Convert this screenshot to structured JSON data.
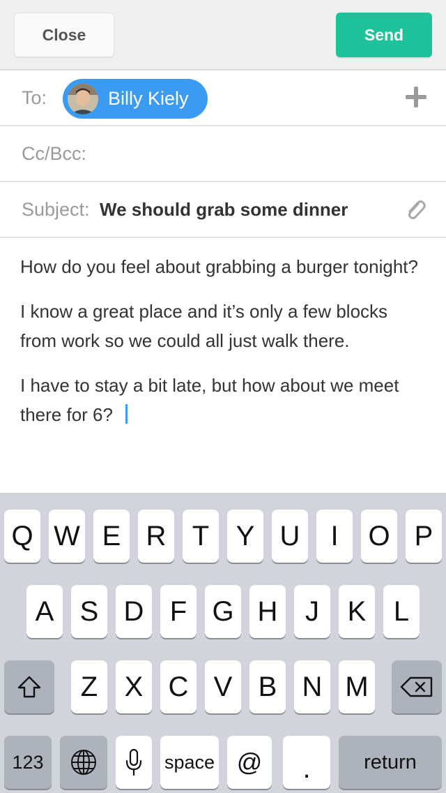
{
  "toolbar": {
    "close_label": "Close",
    "send_label": "Send"
  },
  "to": {
    "label": "To:",
    "recipient": "Billy Kiely"
  },
  "cc": {
    "label": "Cc/Bcc:"
  },
  "subject": {
    "label": "Subject:",
    "value": "We should grab some dinner"
  },
  "body": {
    "paragraphs": [
      "How do you feel about grabbing a burger tonight?",
      "I know a great place and it’s only a few blocks from work so we could all just walk there.",
      "I have to stay a bit late, but how about we meet there for 6?"
    ]
  },
  "keyboard": {
    "row1": [
      "Q",
      "W",
      "E",
      "R",
      "T",
      "Y",
      "U",
      "I",
      "O",
      "P"
    ],
    "row2": [
      "A",
      "S",
      "D",
      "F",
      "G",
      "H",
      "J",
      "K",
      "L"
    ],
    "row3": [
      "Z",
      "X",
      "C",
      "V",
      "B",
      "N",
      "M"
    ],
    "numbers_label": "123",
    "space_label": "space",
    "at_label": "@",
    "period_label": ".",
    "return_label": "return"
  },
  "colors": {
    "send": "#1ec29a",
    "chip": "#3a9bf0",
    "keyboard_bg": "#d1d5db"
  },
  "icons": [
    "plus-icon",
    "paperclip-icon",
    "shift-icon",
    "backspace-icon",
    "globe-icon",
    "microphone-icon"
  ]
}
